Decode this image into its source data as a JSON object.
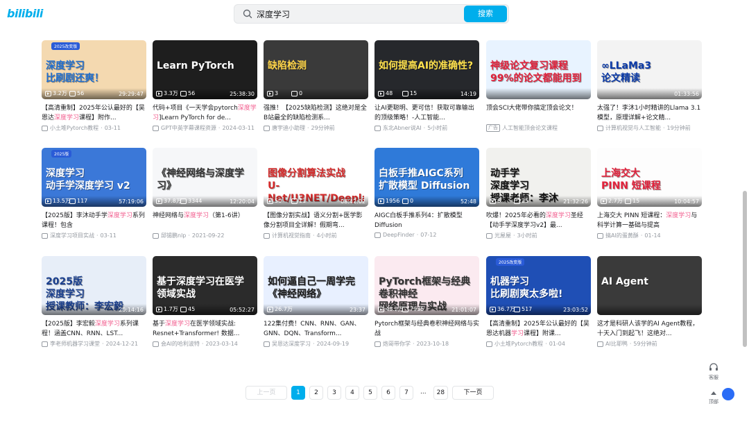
{
  "header": {
    "logo": "bilibili",
    "search_value": "深度学习",
    "search_button": "搜索"
  },
  "colors": {
    "brand": "#00aeec",
    "highlight": "#f25d8e",
    "meta": "#9499a0"
  },
  "videos": [
    {
      "thumb_text": "深度学习\n比刷剧还爽！",
      "badge": "2025改变版",
      "thumb_bg": "#f4d9b0",
      "thumb_fg": "#1f6fd1",
      "views": "3.2万",
      "danmaku": "56",
      "duration": "29:29:47",
      "title_pre": "【高清重制】2025年公认最好的【吴恩达",
      "title_hl": "深度学习",
      "title_post": "课程】附作...",
      "author": "小土堆Pytorch教程",
      "date": "03-11",
      "ad": false
    },
    {
      "thumb_text": "Learn PyTorch",
      "badge": "",
      "thumb_bg": "#1e1e1e",
      "thumb_fg": "#ffffff",
      "views": "3.3万",
      "danmaku": "56",
      "duration": "25:38:30",
      "title_pre": "代码+项目《一天学会pytorch",
      "title_hl": "深度学习",
      "title_post": "]Learn PyTorch for de...",
      "author": "GPT中英字幕课程资源",
      "date": "2024-03-11",
      "ad": false
    },
    {
      "thumb_text": "缺陷检测",
      "badge": "",
      "thumb_bg": "#3a3a3a",
      "thumb_fg": "#ffd54a",
      "views": "3",
      "danmaku": "0",
      "duration": "",
      "title_pre": "强推！【2025缺陷检测】这绝对是全B站最全的缺陷检测系...",
      "title_hl": "",
      "title_post": "",
      "author": "唐宇迪小助理",
      "date": "29分钟前",
      "ad": false
    },
    {
      "thumb_text": "如何提高AI的准确性?",
      "badge": "",
      "thumb_bg": "#26282c",
      "thumb_fg": "#ffe14d",
      "views": "48",
      "danmaku": "15",
      "duration": "14:19",
      "title_pre": "让AI更聪明、更可信！获取可靠输出的顶级策略！-人工智能...",
      "title_hl": "",
      "title_post": "",
      "author": "东北Abner说AI",
      "date": "5小时前",
      "ad": false
    },
    {
      "thumb_text": "神级论文复习课程\n99%的论文都能用到",
      "badge": "",
      "thumb_bg": "#e8f3ff",
      "thumb_fg": "#e2213b",
      "views": "",
      "danmaku": "",
      "duration": "",
      "title_pre": "顶会SCI大佬带你搞定顶会论文！",
      "title_hl": "",
      "title_post": "",
      "author": "人工智能顶会论文课程",
      "date": "",
      "ad": true
    },
    {
      "thumb_text": "∞LLaMa3\n论文精读",
      "badge": "",
      "thumb_bg": "#f3f3f3",
      "thumb_fg": "#0b3aa8",
      "views": "",
      "danmaku": "",
      "duration": "01:33:56",
      "title_pre": "太强了！李沐1小时精讲的Llama 3.1模型，原理详解+论文精...",
      "title_hl": "",
      "title_post": "",
      "author": "计算机视觉与人工智能",
      "date": "19分钟前",
      "ad": false
    },
    {
      "thumb_text": "深度学习\n动手学深度学习 v2",
      "badge": "2025版",
      "thumb_bg": "#3b78d8",
      "thumb_fg": "#ffffff",
      "views": "13.5万",
      "danmaku": "117",
      "duration": "57:19:06",
      "title_pre": "【2025版】李沐动手学",
      "title_hl": "深度学习",
      "title_post": "系列课程！包含",
      "author": "深度学习项目实战",
      "date": "03-11",
      "ad": false
    },
    {
      "thumb_text": "《神经网络与深度学习》",
      "badge": "",
      "thumb_bg": "#f6f7f9",
      "thumb_fg": "#333333",
      "views": "37.8万",
      "danmaku": "3344",
      "duration": "12:20:04",
      "title_pre": "神经网络与",
      "title_hl": "深度学习",
      "title_post": "（第1-6讲）",
      "author": "邱锡鹏nlp",
      "date": "2021-09-22",
      "ad": false
    },
    {
      "thumb_text": "图像分割算法实战\nU-Net/U3NET/Deeplab/MaskRCNN",
      "badge": "",
      "thumb_bg": "#ffffff",
      "thumb_fg": "#d42b2b",
      "views": "50",
      "danmaku": "11",
      "duration": "08:42:02",
      "title_pre": "【图像分割实战】语义分割+医学影像分割项目全详解！假期弯...",
      "title_hl": "",
      "title_post": "",
      "author": "计算机视觉指南",
      "date": "4小时前",
      "ad": false
    },
    {
      "thumb_text": "白板手推AIGC系列\n扩散模型 Diffusion",
      "badge": "",
      "thumb_bg": "#2f7ad9",
      "thumb_fg": "#ffffff",
      "views": "1956",
      "danmaku": "0",
      "duration": "52:48",
      "title_pre": "AIGC白板手推系列4：扩散模型Diffusion",
      "title_hl": "",
      "title_post": "",
      "author": "DeepFinder",
      "date": "07-12",
      "ad": false
    },
    {
      "thumb_text": "动手学\n深度学习\n授课老师：李沐",
      "badge": "",
      "thumb_bg": "#f1f1ee",
      "thumb_fg": "#111111",
      "views": "6",
      "danmaku": "25",
      "duration": "21:32:26",
      "title_pre": "吹爆！2025年必看的",
      "title_hl": "深度学习",
      "title_post": "圣经【动手学深度学习v2】最...",
      "author": "光屋屋",
      "date": "3小时前",
      "ad": false
    },
    {
      "thumb_text": "上海交大\nPINN 短课程",
      "badge": "",
      "thumb_bg": "#fdfdfd",
      "thumb_fg": "#e2213b",
      "views": "2.7万",
      "danmaku": "15",
      "duration": "10:04:57",
      "title_pre": "上海交大 PINN 短课程：",
      "title_hl": "深度学习",
      "title_post": "与科学计算一基础与提高",
      "author": "搞AI的蛋黄酥",
      "date": "01-14",
      "ad": false
    },
    {
      "thumb_text": "2025版\n深度学习\n授课教师：李宏毅",
      "badge": "",
      "thumb_bg": "#e7eef8",
      "thumb_fg": "#1a3f8f",
      "views": "",
      "danmaku": "",
      "duration": "20:14:16",
      "title_pre": "【2025版】李宏毅",
      "title_hl": "深度学习",
      "title_post": "系列课程！涵盖CNN、RNN、LST...",
      "author": "李老师机器学习课堂",
      "date": "2024-12-21",
      "ad": false
    },
    {
      "thumb_text": "基于深度学习在医学领域实战",
      "badge": "",
      "thumb_bg": "#2b2b2b",
      "thumb_fg": "#ffffff",
      "views": "1.7万",
      "danmaku": "45",
      "duration": "05:52:27",
      "title_pre": "基于",
      "title_hl": "深度学习",
      "title_post": "在医学领域实战: Resnet+Transformer! 数据...",
      "author": "会AI的哈利波特",
      "date": "2023-03-14",
      "ad": false
    },
    {
      "thumb_text": "如何逼自己一周学完\n《神经网络》",
      "badge": "",
      "thumb_bg": "#e8f0ff",
      "thumb_fg": "#1a1a1a",
      "views": "26.7万",
      "danmaku": "",
      "duration": "23:37",
      "title_pre": "122集付费！CNN、RNN、GAN、GNN、DQN、Transform...",
      "title_hl": "",
      "title_post": "",
      "author": "吴恩达深度学习",
      "date": "2024-09-19",
      "ad": false
    },
    {
      "thumb_text": "PyTorch框架与经典卷积神经\n网络原理与实战",
      "badge": "",
      "thumb_bg": "#fbeaf0",
      "thumb_fg": "#333333",
      "views": "48.2万",
      "danmaku": "7935",
      "duration": "21:01:07",
      "title_pre": "Pytorch框架与经典卷积神经网络与实战",
      "title_hl": "",
      "title_post": "",
      "author": "炮哥带你学",
      "date": "2023-10-18",
      "ad": false
    },
    {
      "thumb_text": "机器学习\n比刷剧爽太多啦!",
      "badge": "2025改变版",
      "thumb_bg": "#1f4fb5",
      "thumb_fg": "#ffffff",
      "views": "36.7万",
      "danmaku": "517",
      "duration": "23:03:52",
      "title_pre": "【高清重制】2025年公认最好的【吴恩达机器",
      "title_hl": "学习",
      "title_post": "课程】附课...",
      "author": "小土堆Pytorch教程",
      "date": "01-04",
      "ad": false
    },
    {
      "thumb_text": "AI Agent",
      "badge": "",
      "thumb_bg": "#3a3a3a",
      "thumb_fg": "#ffffff",
      "views": "",
      "danmaku": "",
      "duration": "",
      "title_pre": "这才是科研人该学的AI Agent教程，十天入门到起飞！这绝对...",
      "title_hl": "",
      "title_post": "",
      "author": "AI比耶鸭",
      "date": "59分钟前",
      "ad": false
    }
  ],
  "pager": {
    "prev": "上一页",
    "pages": [
      "1",
      "2",
      "3",
      "4",
      "5",
      "6",
      "7",
      "...",
      "28"
    ],
    "active": "1",
    "next": "下一页"
  },
  "side": {
    "service": "客服",
    "top": "顶部"
  }
}
